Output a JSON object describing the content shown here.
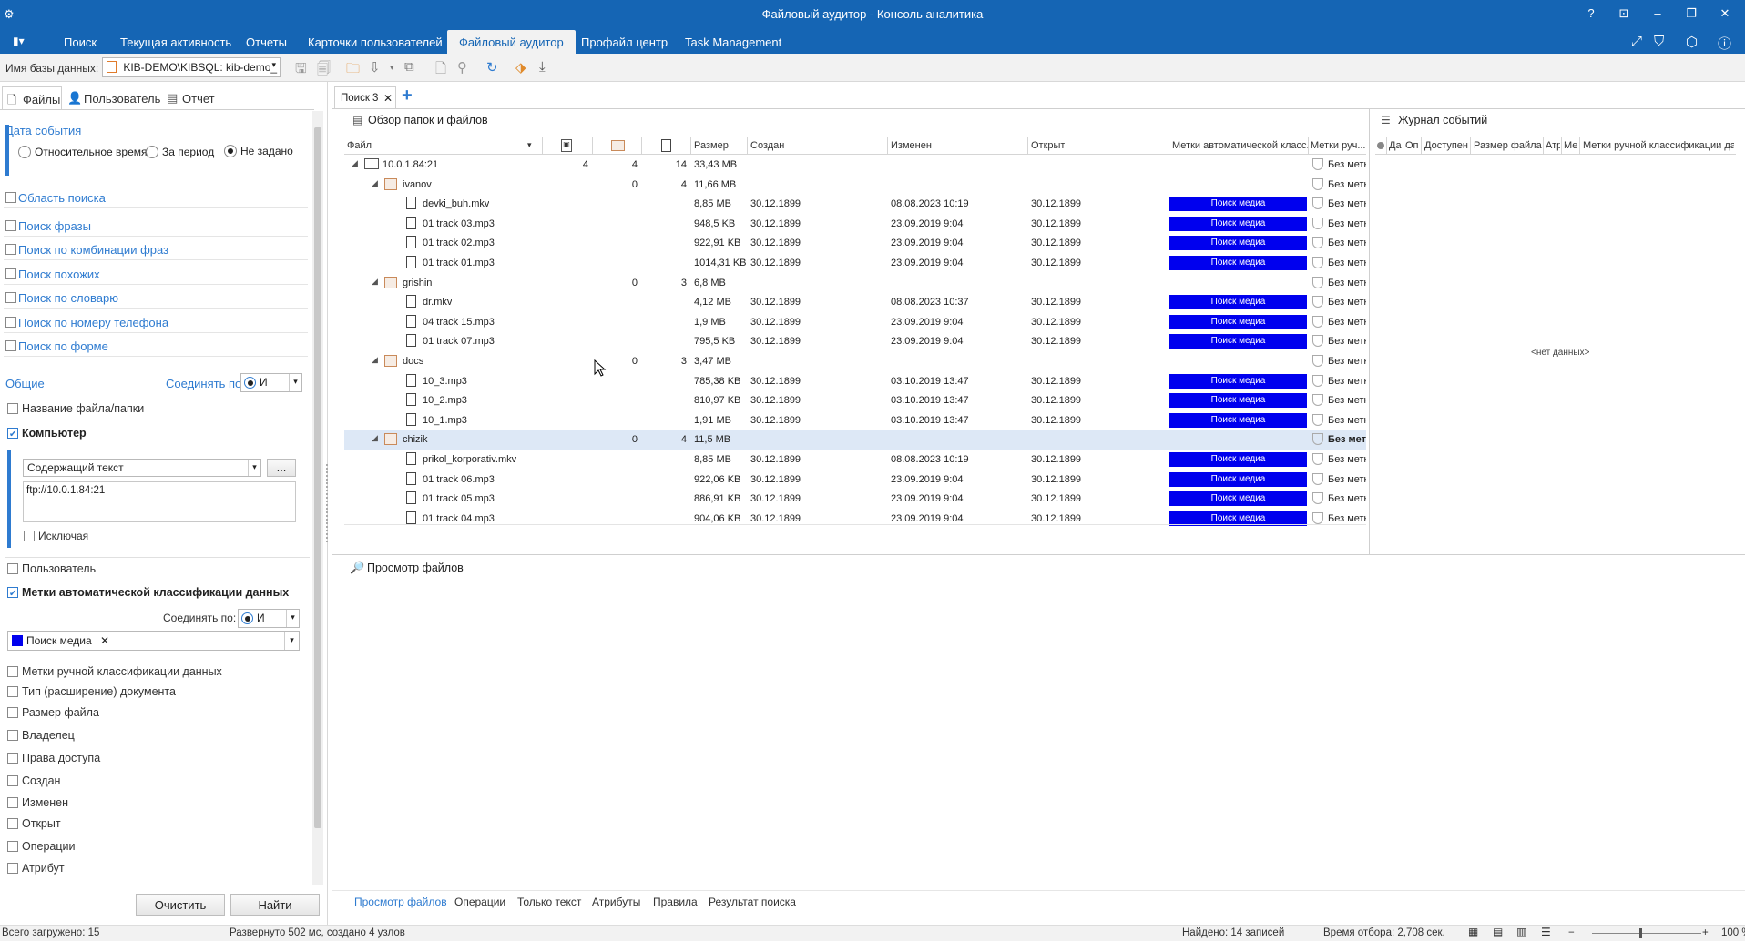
{
  "window": {
    "title": "Файловый аудитор - Консоль аналитика",
    "controls": [
      "?",
      "⊡",
      "–",
      "❐",
      "✕"
    ]
  },
  "menu": {
    "items": [
      "Поиск",
      "Текущая активность",
      "Отчеты",
      "Карточки пользователей",
      "Файловый аудитор",
      "Профайл центр",
      "Task Management"
    ],
    "active_index": 4
  },
  "toolbar": {
    "db_label": "Имя базы данных:",
    "db_value": "KIB-DEMO\\KIBSQL: kib-demo_"
  },
  "left_tabs": [
    "Файлы",
    "Пользователь",
    "Отчет"
  ],
  "left": {
    "event_date_title": "Дата события",
    "radio_options": [
      "Относительное время",
      "За период",
      "Не задано"
    ],
    "radio_selected": 2,
    "sections": [
      "Область поиска",
      "Поиск фразы",
      "Поиск по комбинации фраз",
      "Поиск похожих",
      "Поиск по словарю",
      "Поиск по номеру телефона",
      "Поиск по форме"
    ],
    "common_label": "Общие",
    "join_label": "Соединять по:",
    "join_value": "И",
    "filename_label": "Название файла/папки",
    "computer_label": "Компьютер",
    "contains_value": "Содержащий текст",
    "dots": "...",
    "computer_text": "ftp://10.0.1.84:21",
    "exclude_label": "Исключая",
    "user_label": "Пользователь",
    "auto_label": "Метки автоматической классификации данных",
    "join2_label": "Соединять по:",
    "join2_value": "И",
    "media_chip": "Поиск медиа",
    "chip_close": "✕",
    "more_filters": [
      "Метки ручной классификации данных",
      "Тип (расширение) документа",
      "Размер файла",
      "Владелец",
      "Права доступа",
      "Создан",
      "Изменен",
      "Открыт",
      "Операции",
      "Атрибут"
    ],
    "clear_button": "Очистить",
    "find_button": "Найти"
  },
  "doc_tab": {
    "label": "Поиск 3",
    "close": "✕",
    "add": "+"
  },
  "overview": {
    "title": "Обзор папок и файлов",
    "columns": [
      "Файл",
      "Размер",
      "Создан",
      "Изменен",
      "Открыт",
      "Метки автоматической класс...",
      "Метки руч..."
    ],
    "rows": [
      {
        "level": 0,
        "kind": "pc",
        "name": "10.0.1.84:21",
        "c1": "4",
        "c2": "4",
        "c3": "14",
        "size": "33,43 MB",
        "created": "",
        "modified": "",
        "opened": "",
        "tag": "",
        "manual": "Без метки"
      },
      {
        "level": 1,
        "kind": "folder",
        "name": "ivanov",
        "c1": "",
        "c2": "0",
        "c3": "4",
        "size": "11,66 MB",
        "created": "",
        "modified": "",
        "opened": "",
        "tag": "",
        "manual": "Без метки"
      },
      {
        "level": 2,
        "kind": "file",
        "name": "devki_buh.mkv",
        "c1": "",
        "c2": "",
        "c3": "",
        "size": "8,85 MB",
        "created": "30.12.1899",
        "modified": "08.08.2023 10:19",
        "opened": "30.12.1899",
        "tag": "Поиск медиа",
        "manual": "Без метки"
      },
      {
        "level": 2,
        "kind": "file",
        "name": "01 track 03.mp3",
        "c1": "",
        "c2": "",
        "c3": "",
        "size": "948,5 KB",
        "created": "30.12.1899",
        "modified": "23.09.2019 9:04",
        "opened": "30.12.1899",
        "tag": "Поиск медиа",
        "manual": "Без метки"
      },
      {
        "level": 2,
        "kind": "file",
        "name": "01 track 02.mp3",
        "c1": "",
        "c2": "",
        "c3": "",
        "size": "922,91 KB",
        "created": "30.12.1899",
        "modified": "23.09.2019 9:04",
        "opened": "30.12.1899",
        "tag": "Поиск медиа",
        "manual": "Без метки"
      },
      {
        "level": 2,
        "kind": "file",
        "name": "01 track 01.mp3",
        "c1": "",
        "c2": "",
        "c3": "",
        "size": "1014,31 KB",
        "created": "30.12.1899",
        "modified": "23.09.2019 9:04",
        "opened": "30.12.1899",
        "tag": "Поиск медиа",
        "manual": "Без метки"
      },
      {
        "level": 1,
        "kind": "folder",
        "name": "grishin",
        "c1": "",
        "c2": "0",
        "c3": "3",
        "size": "6,8 MB",
        "created": "",
        "modified": "",
        "opened": "",
        "tag": "",
        "manual": "Без метки"
      },
      {
        "level": 2,
        "kind": "file",
        "name": "dr.mkv",
        "c1": "",
        "c2": "",
        "c3": "",
        "size": "4,12 MB",
        "created": "30.12.1899",
        "modified": "08.08.2023 10:37",
        "opened": "30.12.1899",
        "tag": "Поиск медиа",
        "manual": "Без метки"
      },
      {
        "level": 2,
        "kind": "file",
        "name": "04 track 15.mp3",
        "c1": "",
        "c2": "",
        "c3": "",
        "size": "1,9 MB",
        "created": "30.12.1899",
        "modified": "23.09.2019 9:04",
        "opened": "30.12.1899",
        "tag": "Поиск медиа",
        "manual": "Без метки"
      },
      {
        "level": 2,
        "kind": "file",
        "name": "01 track 07.mp3",
        "c1": "",
        "c2": "",
        "c3": "",
        "size": "795,5 KB",
        "created": "30.12.1899",
        "modified": "23.09.2019 9:04",
        "opened": "30.12.1899",
        "tag": "Поиск медиа",
        "manual": "Без метки"
      },
      {
        "level": 1,
        "kind": "folder",
        "name": "docs",
        "c1": "",
        "c2": "0",
        "c3": "3",
        "size": "3,47 MB",
        "created": "",
        "modified": "",
        "opened": "",
        "tag": "",
        "manual": "Без метки"
      },
      {
        "level": 2,
        "kind": "file",
        "name": "10_3.mp3",
        "c1": "",
        "c2": "",
        "c3": "",
        "size": "785,38 KB",
        "created": "30.12.1899",
        "modified": "03.10.2019 13:47",
        "opened": "30.12.1899",
        "tag": "Поиск медиа",
        "manual": "Без метки"
      },
      {
        "level": 2,
        "kind": "file",
        "name": "10_2.mp3",
        "c1": "",
        "c2": "",
        "c3": "",
        "size": "810,97 KB",
        "created": "30.12.1899",
        "modified": "03.10.2019 13:47",
        "opened": "30.12.1899",
        "tag": "Поиск медиа",
        "manual": "Без метки"
      },
      {
        "level": 2,
        "kind": "file",
        "name": "10_1.mp3",
        "c1": "",
        "c2": "",
        "c3": "",
        "size": "1,91 MB",
        "created": "30.12.1899",
        "modified": "03.10.2019 13:47",
        "opened": "30.12.1899",
        "tag": "Поиск медиа",
        "manual": "Без метки"
      },
      {
        "level": 1,
        "kind": "folder",
        "name": "chizik",
        "c1": "",
        "c2": "0",
        "c3": "4",
        "size": "11,5 MB",
        "created": "",
        "modified": "",
        "opened": "",
        "tag": "",
        "manual": "Без метки",
        "selected": true
      },
      {
        "level": 2,
        "kind": "file",
        "name": "prikol_korporativ.mkv",
        "c1": "",
        "c2": "",
        "c3": "",
        "size": "8,85 MB",
        "created": "30.12.1899",
        "modified": "08.08.2023 10:19",
        "opened": "30.12.1899",
        "tag": "Поиск медиа",
        "manual": "Без метки"
      },
      {
        "level": 2,
        "kind": "file",
        "name": "01 track 06.mp3",
        "c1": "",
        "c2": "",
        "c3": "",
        "size": "922,06 KB",
        "created": "30.12.1899",
        "modified": "23.09.2019 9:04",
        "opened": "30.12.1899",
        "tag": "Поиск медиа",
        "manual": "Без метки"
      },
      {
        "level": 2,
        "kind": "file",
        "name": "01 track 05.mp3",
        "c1": "",
        "c2": "",
        "c3": "",
        "size": "886,91 KB",
        "created": "30.12.1899",
        "modified": "23.09.2019 9:04",
        "opened": "30.12.1899",
        "tag": "Поиск медиа",
        "manual": "Без метки"
      },
      {
        "level": 2,
        "kind": "file",
        "name": "01 track 04.mp3",
        "c1": "",
        "c2": "",
        "c3": "",
        "size": "904,06 KB",
        "created": "30.12.1899",
        "modified": "23.09.2019 9:04",
        "opened": "30.12.1899",
        "tag": "Поиск медиа",
        "manual": "Без метки"
      }
    ]
  },
  "journal": {
    "title": "Журнал событий",
    "columns": [
      "Да",
      "Оп",
      "Доступен",
      "Размер файла",
      "Атр",
      "Ме",
      "Метки ручной классификации данн"
    ],
    "empty": "<нет данных>"
  },
  "preview": {
    "title": "Просмотр файлов"
  },
  "bottom_tabs": [
    "Просмотр файлов",
    "Операции",
    "Только текст",
    "Атрибуты",
    "Правила",
    "Результат поиска"
  ],
  "status": {
    "loaded": "Всего загружено: 15",
    "expanded": "Развернуто 502 мс, создано 4 узлов",
    "found": "Найдено: 14 записей",
    "time": "Время отбора: 2,708 сек.",
    "zoom": "100 %"
  },
  "colors": {
    "accent": "#1565b4",
    "tag": "#0000ee",
    "link": "#2e7bd0",
    "selected_row": "#dde8f6"
  }
}
